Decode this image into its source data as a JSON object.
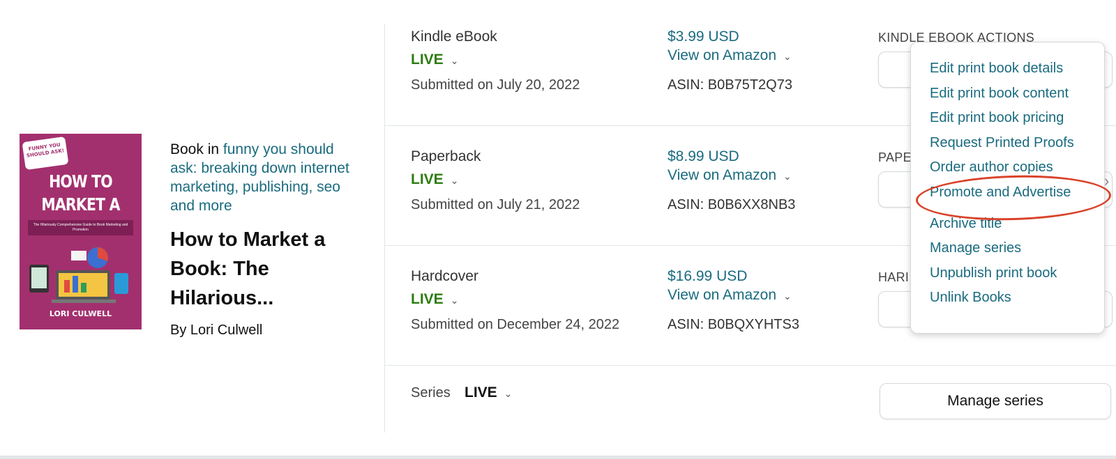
{
  "book": {
    "cover": {
      "bubble_text": "FUNNY YOU SHOULD ASK!",
      "title_line1": "HOW TO",
      "title_line2": "MARKET A BOOK",
      "subtitle": "The Hilariously Comprehensive Guide to Book Marketing and Promotion",
      "author": "LORI CULWELL"
    },
    "book_in_prefix": "Book in ",
    "series_name": "funny you should ask: breaking down internet marketing, publishing, seo and more",
    "title": "How to Market a Book: The Hilarious...",
    "author": "By Lori Culwell"
  },
  "formats": [
    {
      "name": "Kindle eBook",
      "status": "LIVE",
      "submitted": "Submitted on July 20, 2022",
      "price": "$3.99 USD",
      "view_link": "View on Amazon",
      "asin": "ASIN: B0B75T2Q73",
      "actions_label": "KINDLE EBOOK ACTIONS"
    },
    {
      "name": "Paperback",
      "status": "LIVE",
      "submitted": "Submitted on July 21, 2022",
      "price": "$8.99 USD",
      "view_link": "View on Amazon",
      "asin": "ASIN: B0B6XX8NB3",
      "actions_label": "PAPE"
    },
    {
      "name": "Hardcover",
      "status": "LIVE",
      "submitted": "Submitted on December 24, 2022",
      "price": "$16.99 USD",
      "view_link": "View on Amazon",
      "asin": "ASIN: B0BQXYHTS3",
      "actions_label": "HARI"
    }
  ],
  "series_row": {
    "label": "Series",
    "status": "LIVE",
    "button": "Manage series"
  },
  "menu": {
    "items": [
      "Edit print book details",
      "Edit print book content",
      "Edit print book pricing",
      "Request Printed Proofs",
      "Order author copies",
      "Promote and Advertise",
      "Archive title",
      "Manage series",
      "Unpublish print book",
      "Unlink Books"
    ],
    "highlighted_item": "Promote and Advertise"
  },
  "colors": {
    "live_green": "#2e7d12",
    "link_teal": "#1a6b7f",
    "highlight_red": "#d9432b",
    "cover_magenta": "#a3306e"
  },
  "icons": {
    "chevron": "chevron-down-icon",
    "side": "chevron-right-icon"
  }
}
